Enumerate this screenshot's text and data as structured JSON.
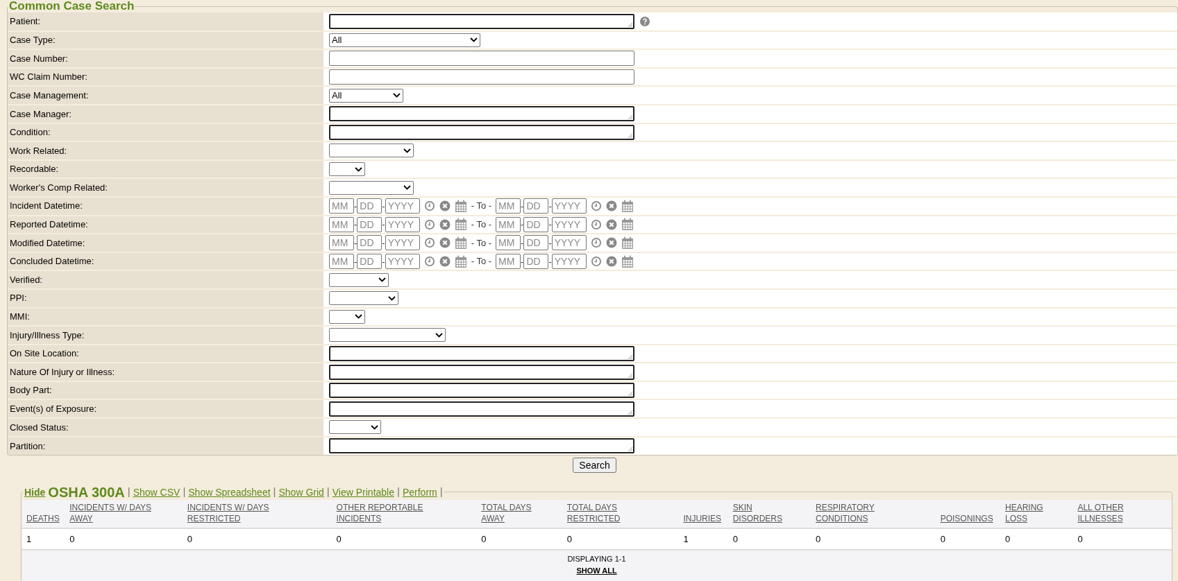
{
  "search_form": {
    "title": "Common Case Search",
    "fields": [
      {
        "label": "Patient:",
        "kind": "lookup",
        "help": true
      },
      {
        "label": "Case Type:",
        "kind": "select",
        "value": "All"
      },
      {
        "label": "Case Number:",
        "kind": "text"
      },
      {
        "label": "WC Claim Number:",
        "kind": "text"
      },
      {
        "label": "Case Management:",
        "kind": "select",
        "value": "All"
      },
      {
        "label": "Case Manager:",
        "kind": "lookup"
      },
      {
        "label": "Condition:",
        "kind": "lookup"
      },
      {
        "label": "Work Related:",
        "kind": "select"
      },
      {
        "label": "Recordable:",
        "kind": "select"
      },
      {
        "label": "Worker's Comp Related:",
        "kind": "select"
      },
      {
        "label": "Incident Datetime:",
        "kind": "daterange",
        "from": [
          {
            "placeholder": "MM"
          },
          {
            "separator": "-",
            "placeholder": "DD"
          },
          {
            "separator": "-",
            "placeholder": "YYYY"
          }
        ],
        "to_label": "- To -",
        "to": [
          {
            "placeholder": "MM"
          },
          {
            "separator": "-",
            "placeholder": "DD"
          },
          {
            "separator": "-",
            "placeholder": "YYYY"
          }
        ]
      },
      {
        "label": "Reported Datetime:",
        "kind": "daterange",
        "from": [
          {
            "placeholder": "MM"
          },
          {
            "separator": "-",
            "placeholder": "DD"
          },
          {
            "separator": "-",
            "placeholder": "YYYY"
          }
        ],
        "to_label": "- To -",
        "to": [
          {
            "placeholder": "MM"
          },
          {
            "separator": "-",
            "placeholder": "DD"
          },
          {
            "separator": "-",
            "placeholder": "YYYY"
          }
        ]
      },
      {
        "label": "Modified Datetime:",
        "kind": "daterange",
        "from": [
          {
            "placeholder": "MM"
          },
          {
            "separator": "-",
            "placeholder": "DD"
          },
          {
            "separator": "-",
            "placeholder": "YYYY"
          }
        ],
        "to_label": "- To -",
        "to": [
          {
            "placeholder": "MM"
          },
          {
            "separator": "-",
            "placeholder": "DD"
          },
          {
            "separator": "-",
            "placeholder": "YYYY"
          }
        ]
      },
      {
        "label": "Concluded Datetime:",
        "kind": "daterange",
        "from": [
          {
            "placeholder": "MM"
          },
          {
            "separator": "-",
            "placeholder": "DD"
          },
          {
            "separator": "-",
            "placeholder": "YYYY"
          }
        ],
        "to_label": "- To -",
        "to": [
          {
            "placeholder": "MM"
          },
          {
            "separator": "-",
            "placeholder": "DD"
          },
          {
            "separator": "-",
            "placeholder": "YYYY"
          }
        ]
      },
      {
        "label": "Verified:",
        "kind": "select"
      },
      {
        "label": "PPI:",
        "kind": "select"
      },
      {
        "label": "MMI:",
        "kind": "select"
      },
      {
        "label": "Injury/Illness Type:",
        "kind": "select"
      },
      {
        "label": "On Site Location:",
        "kind": "lookup"
      },
      {
        "label": "Nature Of Injury or Illness:",
        "kind": "lookup"
      },
      {
        "label": "Body Part:",
        "kind": "lookup"
      },
      {
        "label": "Event(s) of Exposure:",
        "kind": "lookup"
      },
      {
        "label": "Closed Status:",
        "kind": "select"
      },
      {
        "label": "Partition:",
        "kind": "lookup"
      }
    ],
    "search_button": "Search"
  },
  "osha_300a": {
    "hide_link": "Hide",
    "title": "OSHA 300A",
    "title_separator": "|",
    "links": [
      {
        "label": "Show CSV",
        "separator": "|"
      },
      {
        "label": "Show Spreadsheet",
        "separator": "|"
      },
      {
        "label": "Show Grid",
        "separator": "|"
      },
      {
        "label": "View Printable",
        "separator": "|"
      },
      {
        "label": "Perform",
        "separator": "|"
      }
    ],
    "columns": [
      "DEATHS",
      "INCIDENTS W/ DAYS AWAY",
      "INCIDENTS W/ DAYS RESTRICTED",
      "OTHER REPORTABLE INCIDENTS",
      "TOTAL DAYS AWAY",
      "TOTAL DAYS RESTRICTED",
      "INJURIES",
      "SKIN DISORDERS",
      "RESPIRATORY CONDITIONS",
      "POISONINGS",
      "HEARING LOSS",
      "ALL OTHER ILLNESSES"
    ],
    "rows": [
      [
        "1",
        "0",
        "0",
        "0",
        "0",
        "0",
        "1",
        "0",
        "0",
        "0",
        "0",
        "0"
      ]
    ],
    "footer": {
      "displaying": "DISPLAYING 1-1",
      "show_all": "SHOW ALL"
    }
  }
}
